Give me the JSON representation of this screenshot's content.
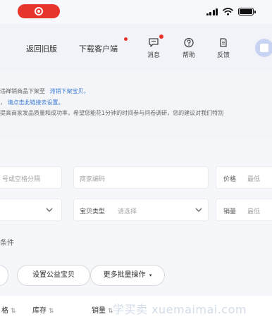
{
  "status_bar": {
    "recording_indicator": "record-icon"
  },
  "nav": {
    "return_old": "返回旧版",
    "download_client": "下载客户端",
    "messages": "消息",
    "help": "帮助",
    "feedback": "反馈"
  },
  "notice": {
    "line1_gray": "违禅销商品下架至",
    "line1_link": "滞销下架宝贝，",
    "line2_gray": "，",
    "line2_link": "请点击此链接去设置。",
    "line3_gray": "提高商家发品质量和成功率，希望您能花1分钟的时间参与问卷调研，您的建议对我们特别"
  },
  "filters": {
    "category_placeholder": "号或空格分隔",
    "merchant_code_placeholder": "商家编码",
    "price_label": "价格",
    "price_placeholder": "最低",
    "item_type_label": "宝贝类型",
    "item_type_placeholder": "请选择",
    "sales_label": "销量",
    "sales_placeholder": "最低",
    "conditions_label": "条件"
  },
  "actions": {
    "set_charity": "设置公益宝贝",
    "more_batch": "更多批量操作"
  },
  "table": {
    "columns": [
      "格",
      "库存",
      "销量"
    ],
    "watermark": "学买卖 xuemaimai.com"
  },
  "colors": {
    "accent_red": "#e8352b",
    "link_blue": "#3a7bd5"
  }
}
